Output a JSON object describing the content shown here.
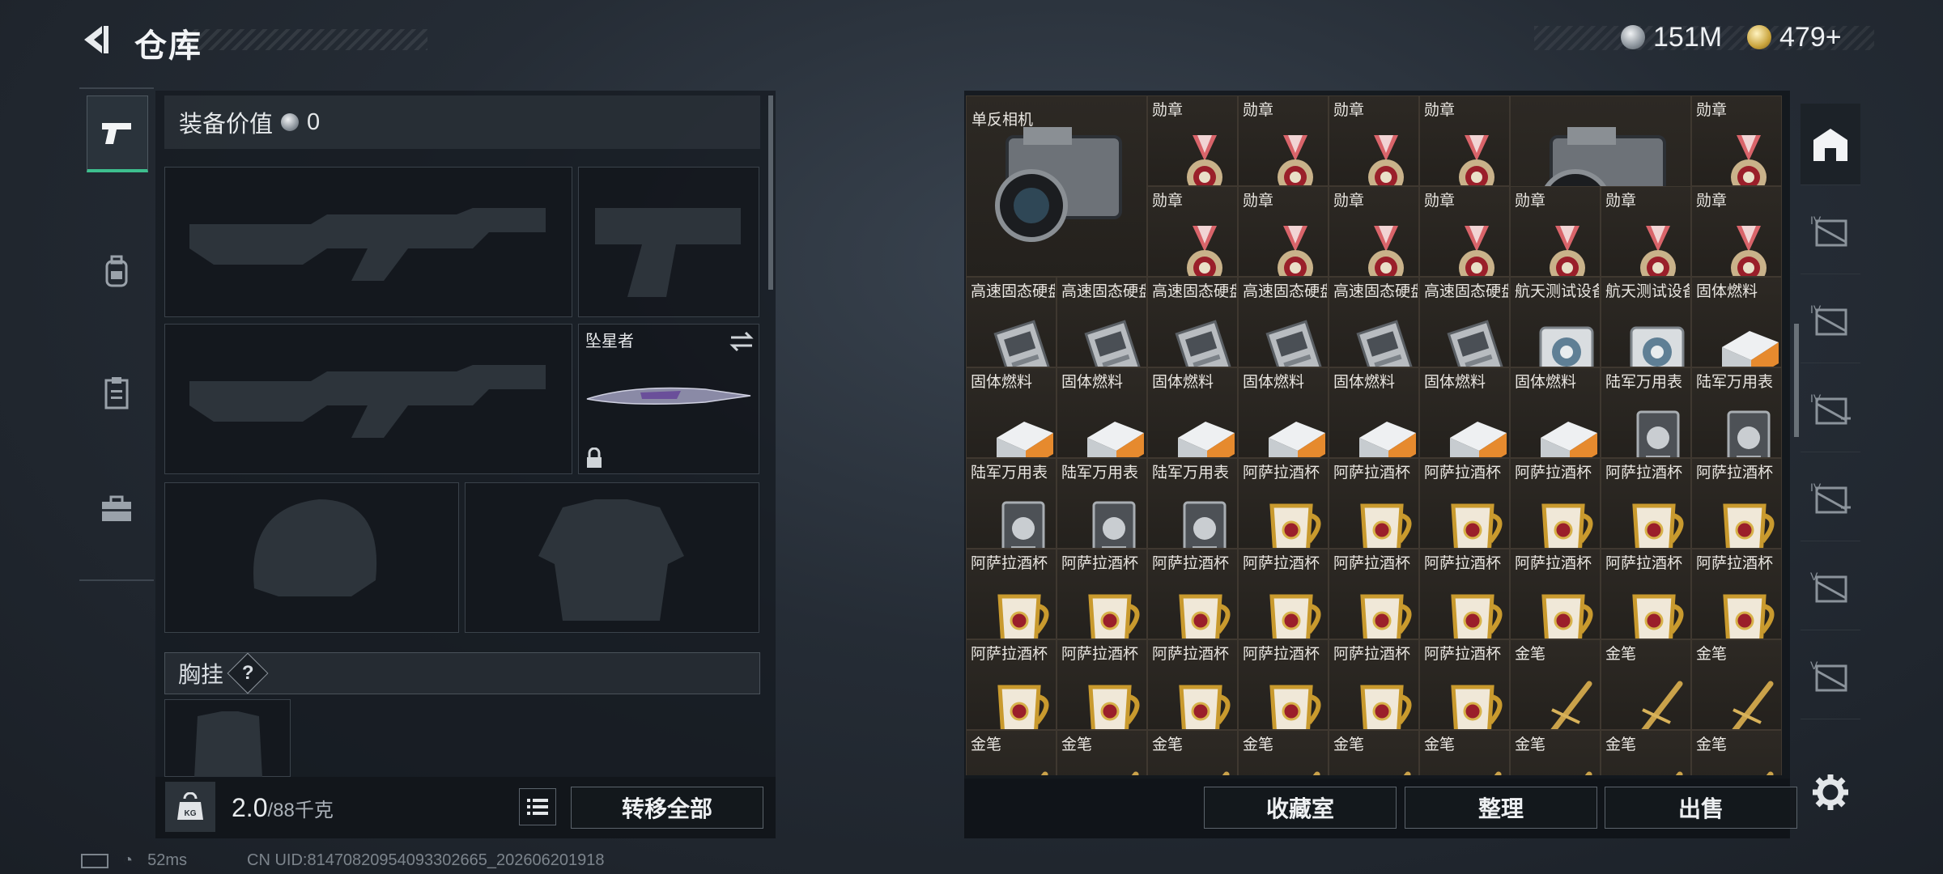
{
  "header": {
    "title": "仓库",
    "back_icon": "back-arrow-icon"
  },
  "currency": [
    {
      "icon": "silver-coin-icon",
      "value": "151M"
    },
    {
      "icon": "gold-coin-icon",
      "value": "479+"
    }
  ],
  "nav": [
    {
      "icon": "pistol-icon",
      "active": true
    },
    {
      "icon": "backpack-icon",
      "active": false
    },
    {
      "icon": "clipboard-icon",
      "active": false
    },
    {
      "icon": "toolbox-icon",
      "active": false
    }
  ],
  "loadout": {
    "value_label": "装备价值",
    "value": "0",
    "melee_name": "坠星者",
    "chest_rig_label": "胸挂",
    "chest_rig_hint": "?",
    "weight_value": "2.0",
    "weight_max": "/88千克",
    "weight_icon": "KG",
    "transfer_all": "转移全部"
  },
  "grid": {
    "big_items": [
      {
        "label": "单反相机",
        "icon": "camera-icon"
      },
      {
        "label": "",
        "icon": "camera-icon"
      }
    ],
    "rows": [
      [
        "勋章",
        "勋章",
        "勋章",
        "勋章",
        "勋章"
      ],
      [
        "勋章",
        "勋章",
        "勋章",
        "勋章",
        "勋章",
        "勋章",
        "勋章"
      ],
      [
        "高速固态硬盘",
        "高速固态硬盘",
        "高速固态硬盘",
        "高速固态硬盘",
        "高速固态硬盘",
        "高速固态硬盘",
        "航天测试设备",
        "航天测试设备",
        "固体燃料"
      ],
      [
        "固体燃料",
        "固体燃料",
        "固体燃料",
        "固体燃料",
        "固体燃料",
        "固体燃料",
        "固体燃料",
        "陆军万用表",
        "陆军万用表"
      ],
      [
        "陆军万用表",
        "陆军万用表",
        "陆军万用表",
        "阿萨拉酒杯",
        "阿萨拉酒杯",
        "阿萨拉酒杯",
        "阿萨拉酒杯",
        "阿萨拉酒杯",
        "阿萨拉酒杯"
      ],
      [
        "阿萨拉酒杯",
        "阿萨拉酒杯",
        "阿萨拉酒杯",
        "阿萨拉酒杯",
        "阿萨拉酒杯",
        "阿萨拉酒杯",
        "阿萨拉酒杯",
        "阿萨拉酒杯",
        "阿萨拉酒杯"
      ],
      [
        "阿萨拉酒杯",
        "阿萨拉酒杯",
        "阿萨拉酒杯",
        "阿萨拉酒杯",
        "阿萨拉酒杯",
        "阿萨拉酒杯",
        "金笔",
        "金笔",
        "金笔"
      ],
      [
        "金笔",
        "金笔",
        "金笔",
        "金笔",
        "金笔",
        "金笔",
        "金笔",
        "金笔",
        "金笔"
      ]
    ]
  },
  "grid_buttons": {
    "collection": "收藏室",
    "organize": "整理",
    "sell": "出售"
  },
  "rail": [
    {
      "icon": "safehouse-icon",
      "active": true
    },
    {
      "icon": "storage-iv-icon",
      "label": "IV"
    },
    {
      "icon": "storage-iv-icon",
      "label": "IV"
    },
    {
      "icon": "storage-iv-add-icon",
      "label": "IV"
    },
    {
      "icon": "storage-iv-add-icon",
      "label": "IV"
    },
    {
      "icon": "storage-v-icon",
      "label": "V"
    },
    {
      "icon": "storage-v-icon",
      "label": "V"
    }
  ],
  "status": {
    "ping": "52ms",
    "uid": "CN UID:8147082095409330266​5_202606201918"
  }
}
